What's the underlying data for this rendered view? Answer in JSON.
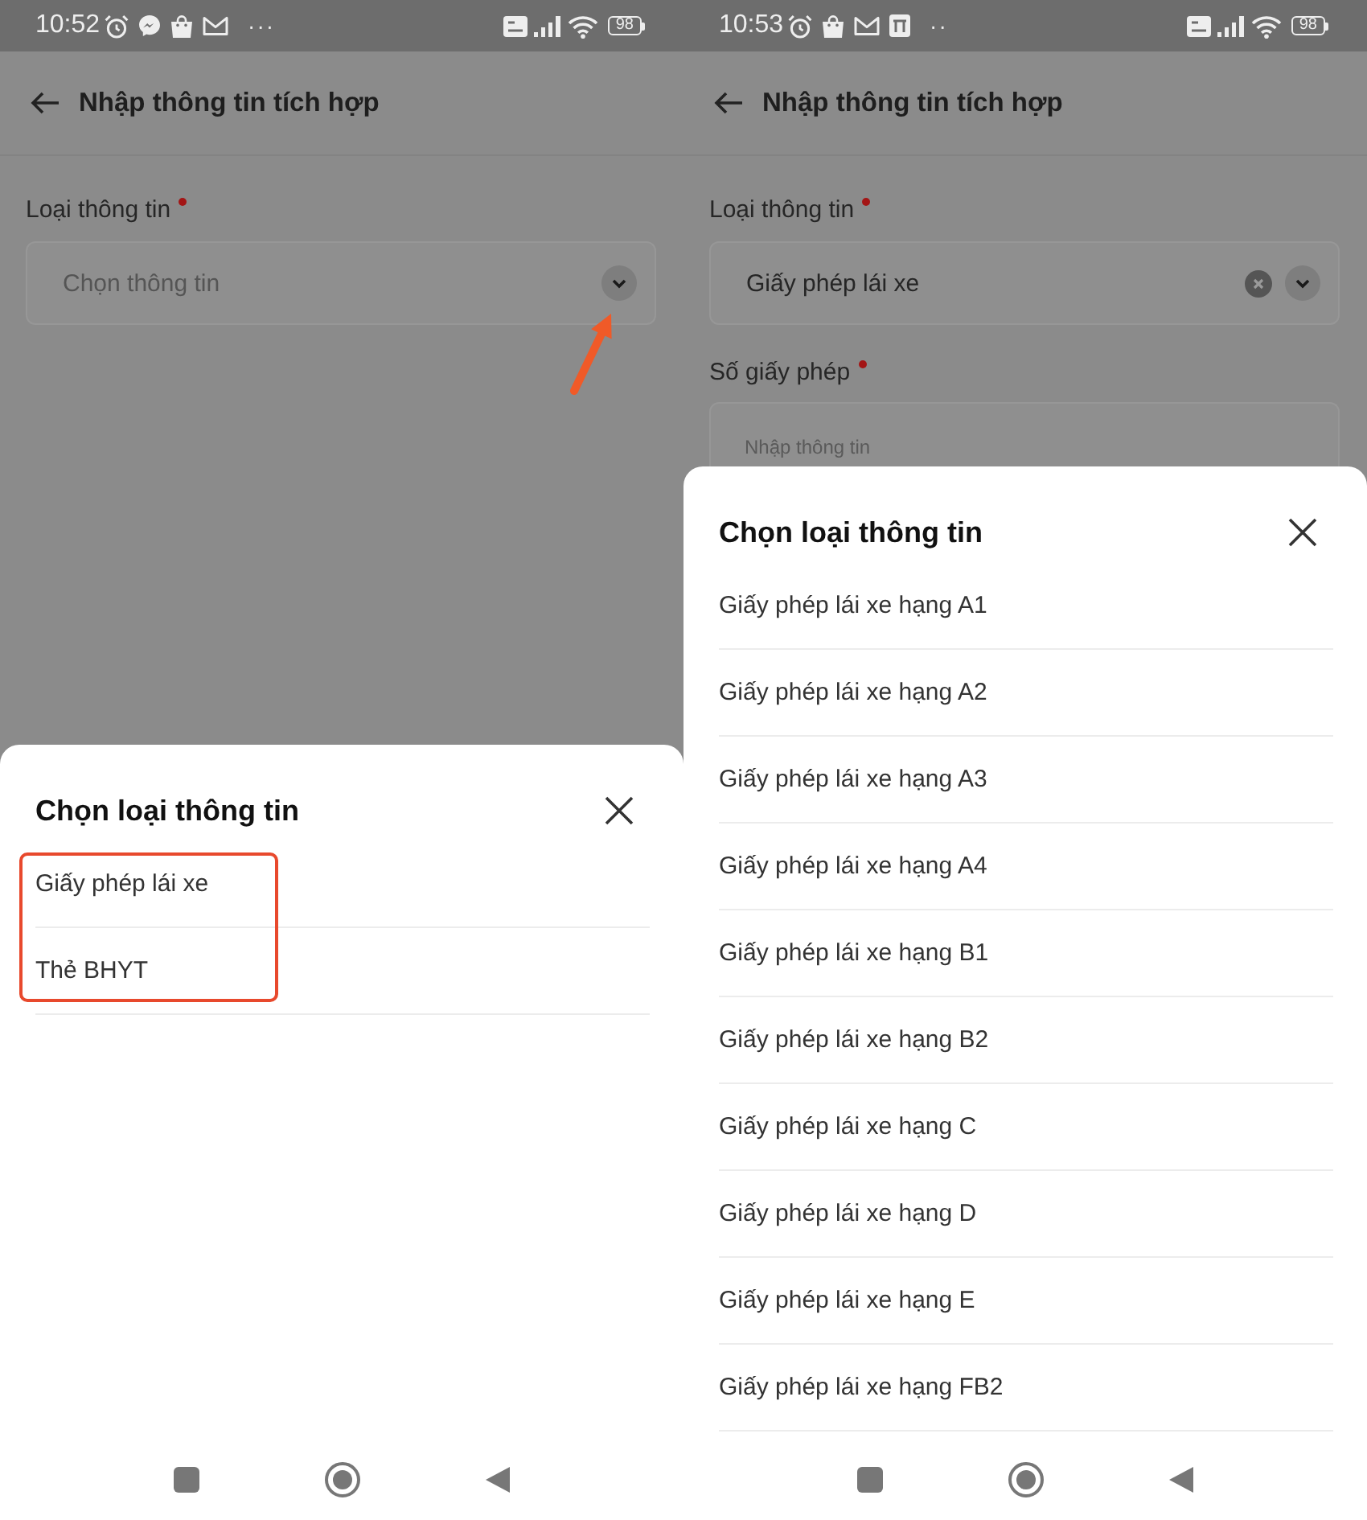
{
  "screens": [
    {
      "status_bar": {
        "time": "10:52",
        "notification_icons": [
          {
            "kind": "alarm"
          },
          {
            "kind": "messenger"
          },
          {
            "kind": "bag"
          },
          {
            "kind": "mail"
          }
        ],
        "more": "···",
        "battery": "98"
      },
      "header": {
        "title": "Nhập thông tin tích hợp"
      },
      "form": {
        "fields": [
          {
            "kind": "select",
            "label": "Loại thông tin",
            "required": true,
            "placeholder": "Chọn thông tin",
            "callout_arrow": true
          }
        ]
      },
      "sheet": {
        "title": "Chọn loại thông tin",
        "highlight_box": true,
        "options": [
          {
            "label": "Giấy phép lái xe",
            "selected": false
          },
          {
            "label": "Thẻ BHYT",
            "selected": false
          }
        ]
      }
    },
    {
      "status_bar": {
        "time": "10:53",
        "notification_icons": [
          {
            "kind": "alarm"
          },
          {
            "kind": "bag"
          },
          {
            "kind": "mail"
          },
          {
            "kind": "app"
          }
        ],
        "more": "··",
        "battery": "98"
      },
      "header": {
        "title": "Nhập thông tin tích hợp"
      },
      "form": {
        "fields": [
          {
            "kind": "select",
            "label": "Loại thông tin",
            "required": true,
            "value": "Giấy phép lái xe",
            "clearable": true
          },
          {
            "kind": "text",
            "label": "Số giấy phép",
            "required": true,
            "placeholder": "Nhập thông tin"
          }
        ]
      },
      "sheet": {
        "title": "Chọn loại thông tin",
        "options": [
          {
            "label": "Giấy phép lái xe hạng A1",
            "selected": false
          },
          {
            "label": "Giấy phép lái xe hạng A2",
            "selected": false
          },
          {
            "label": "Giấy phép lái xe hạng A3",
            "selected": false
          },
          {
            "label": "Giấy phép lái xe hạng A4",
            "selected": false
          },
          {
            "label": "Giấy phép lái xe hạng B1",
            "selected": false
          },
          {
            "label": "Giấy phép lái xe hạng B2",
            "selected": false
          },
          {
            "label": "Giấy phép lái xe hạng C",
            "selected": false
          },
          {
            "label": "Giấy phép lái xe hạng D",
            "selected": false
          },
          {
            "label": "Giấy phép lái xe hạng E",
            "selected": false
          },
          {
            "label": "Giấy phép lái xe hạng FB2",
            "selected": false
          }
        ]
      }
    }
  ]
}
